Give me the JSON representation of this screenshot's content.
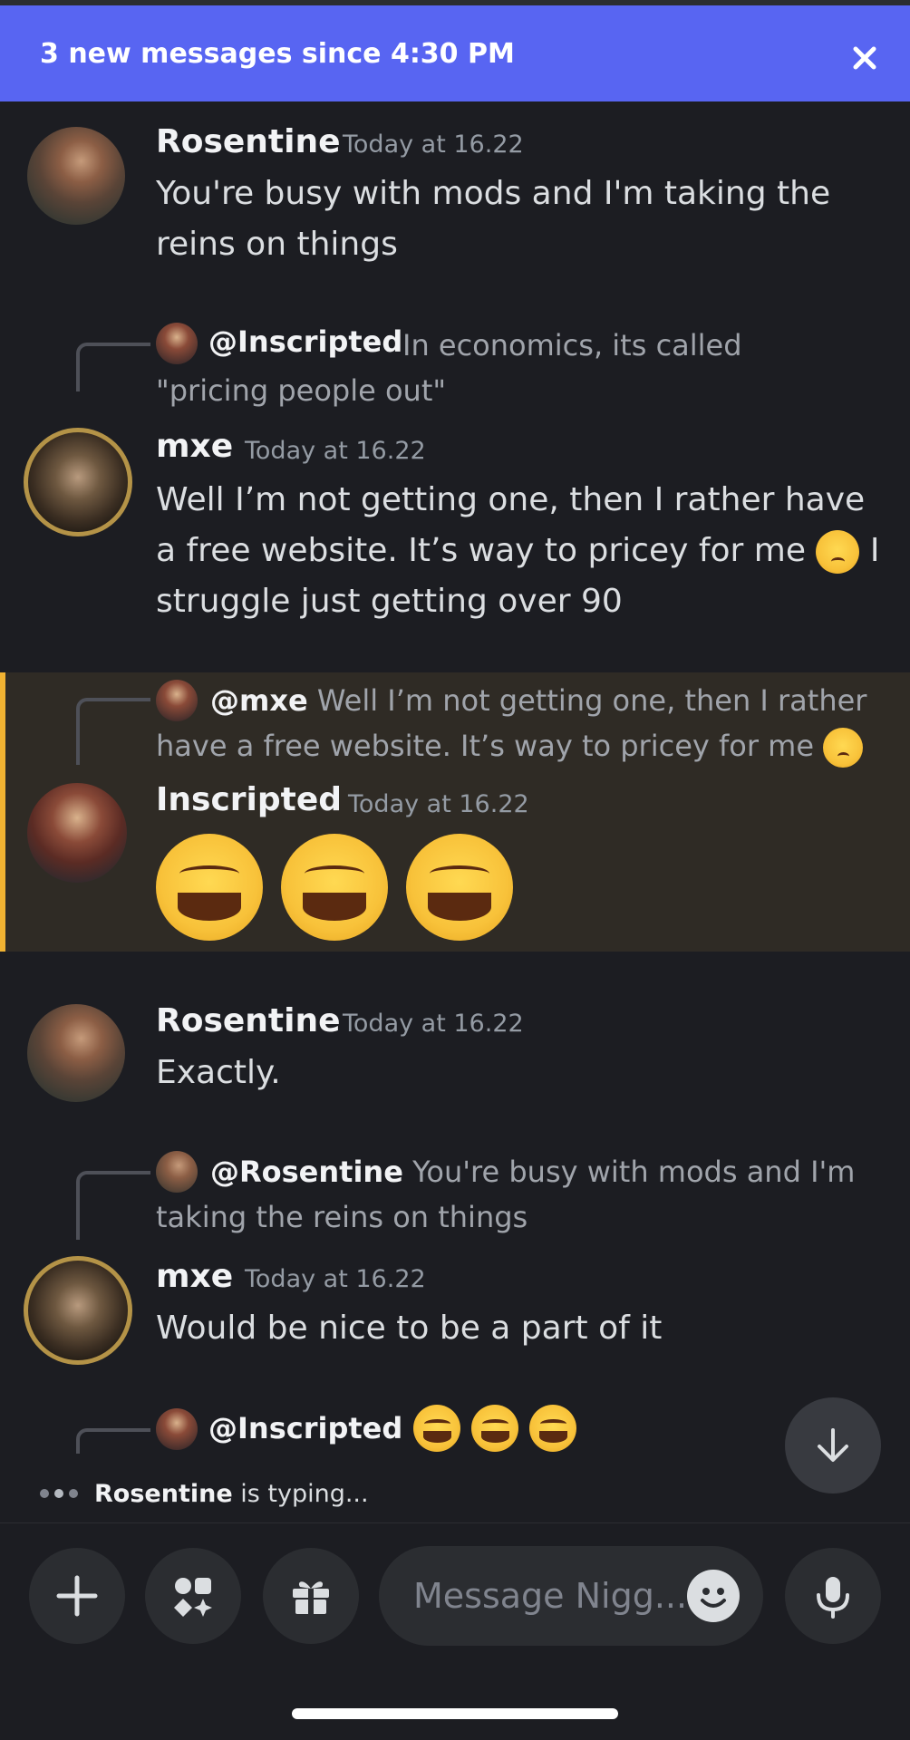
{
  "banner": {
    "text": "3 new messages since 4:30 PM"
  },
  "messages": [
    {
      "author": "Rosentine",
      "time": "Today at 16.22",
      "text": "You're busy with mods and I'm taking the reins on things"
    },
    {
      "reply_to": "@Inscripted",
      "reply_text": "In economics, its called \"pricing people out\"",
      "author": "mxe",
      "time": "Today at 16.22",
      "text_a": "Well I’m not getting one, then I rather have a free website. It’s way to pricey for me",
      "text_b": "I struggle just getting over 90"
    },
    {
      "reply_to": "@mxe",
      "reply_text": "Well I’m not getting one, then I rather have a free website. It’s way to pricey for me",
      "author": "Inscripted",
      "time": "Today at 16.22"
    },
    {
      "author": "Rosentine",
      "time": "Today at 16.22",
      "text": "Exactly."
    },
    {
      "reply_to": "@Rosentine",
      "reply_text": "You're busy with mods and I'm taking the reins on things",
      "author": "mxe",
      "time": "Today at 16.22",
      "text": "Would be nice to be a part of it"
    },
    {
      "reply_to": "@Inscripted"
    }
  ],
  "typing": {
    "user": "Rosentine",
    "suffix": " is typing..."
  },
  "composer": {
    "placeholder": "Message Nigg..."
  },
  "icons": [
    "close-icon",
    "scroll-down-icon",
    "plus-icon",
    "apps-icon",
    "gift-icon",
    "emoji-icon",
    "microphone-icon"
  ]
}
